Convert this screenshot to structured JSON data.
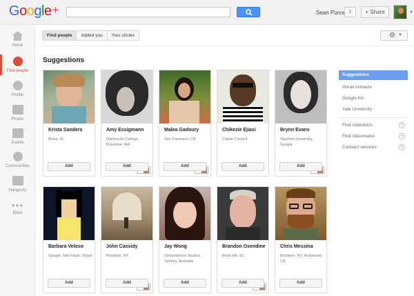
{
  "header": {
    "logo_text": "Google",
    "logo_plus": "+",
    "search_placeholder": "",
    "user_name": "Sean Purcell",
    "notification_count": "0",
    "share_label": "+ Share"
  },
  "sidebar": {
    "items": [
      {
        "label": "Home",
        "icon": "home-icon"
      },
      {
        "label": "Find people",
        "icon": "find-people-icon"
      },
      {
        "label": "Profile",
        "icon": "profile-icon"
      },
      {
        "label": "Photos",
        "icon": "photos-icon"
      },
      {
        "label": "Events",
        "icon": "events-icon"
      },
      {
        "label": "Communities",
        "icon": "communities-icon"
      },
      {
        "label": "Hangouts",
        "icon": "hangouts-icon"
      },
      {
        "label": "More",
        "icon": "more-icon"
      }
    ]
  },
  "tabs": [
    {
      "label": "Find people"
    },
    {
      "label": "Added you"
    },
    {
      "label": "Your circles"
    }
  ],
  "page_title": "Suggestions",
  "cards": [
    {
      "name": "Krista Sanders",
      "sub": "Boise, ID",
      "add": "Add"
    },
    {
      "name": "Amy Essigmann",
      "sub": "Dartmouth College, Brookline, MA",
      "add": "Add",
      "mini": "9"
    },
    {
      "name": "Malea Gadoury",
      "sub": "San Francisco, CA",
      "add": "Add",
      "mini": "4"
    },
    {
      "name": "Chikezie Ejiasi",
      "sub": "Cuban Council",
      "add": "Add"
    },
    {
      "name": "Brynn Evans",
      "sub": "Stanford University, Google",
      "add": "Add",
      "mini": "3"
    },
    {
      "name": "Barbara Veloso",
      "sub": "Google, São Paulo, Brazil",
      "add": "Add"
    },
    {
      "name": "John Cassidy",
      "sub": "Brooklyn, NY",
      "add": "Add",
      "mini": "9"
    },
    {
      "name": "Jay Wong",
      "sub": "Omnommom Studios, Sydney, Australia",
      "add": "Add"
    },
    {
      "name": "Brandon Oxendine",
      "sub": "Rock Hill, SC",
      "add": "Add",
      "mini": "3"
    },
    {
      "name": "Chris Messina",
      "sub": "Brooklyn, NY, Hollywood, CA",
      "add": "Add"
    }
  ],
  "right_panel": {
    "active": "Suggestions",
    "items": [
      "Gmail contacts",
      "Google Inc.",
      "Yale University"
    ],
    "actions": [
      "Find coworkers",
      "Find classmates",
      "Connect services"
    ]
  },
  "colors": {
    "accent_blue": "#4d90fe",
    "accent_red": "#dd4b39",
    "panel_active": "#6a9ff0"
  }
}
